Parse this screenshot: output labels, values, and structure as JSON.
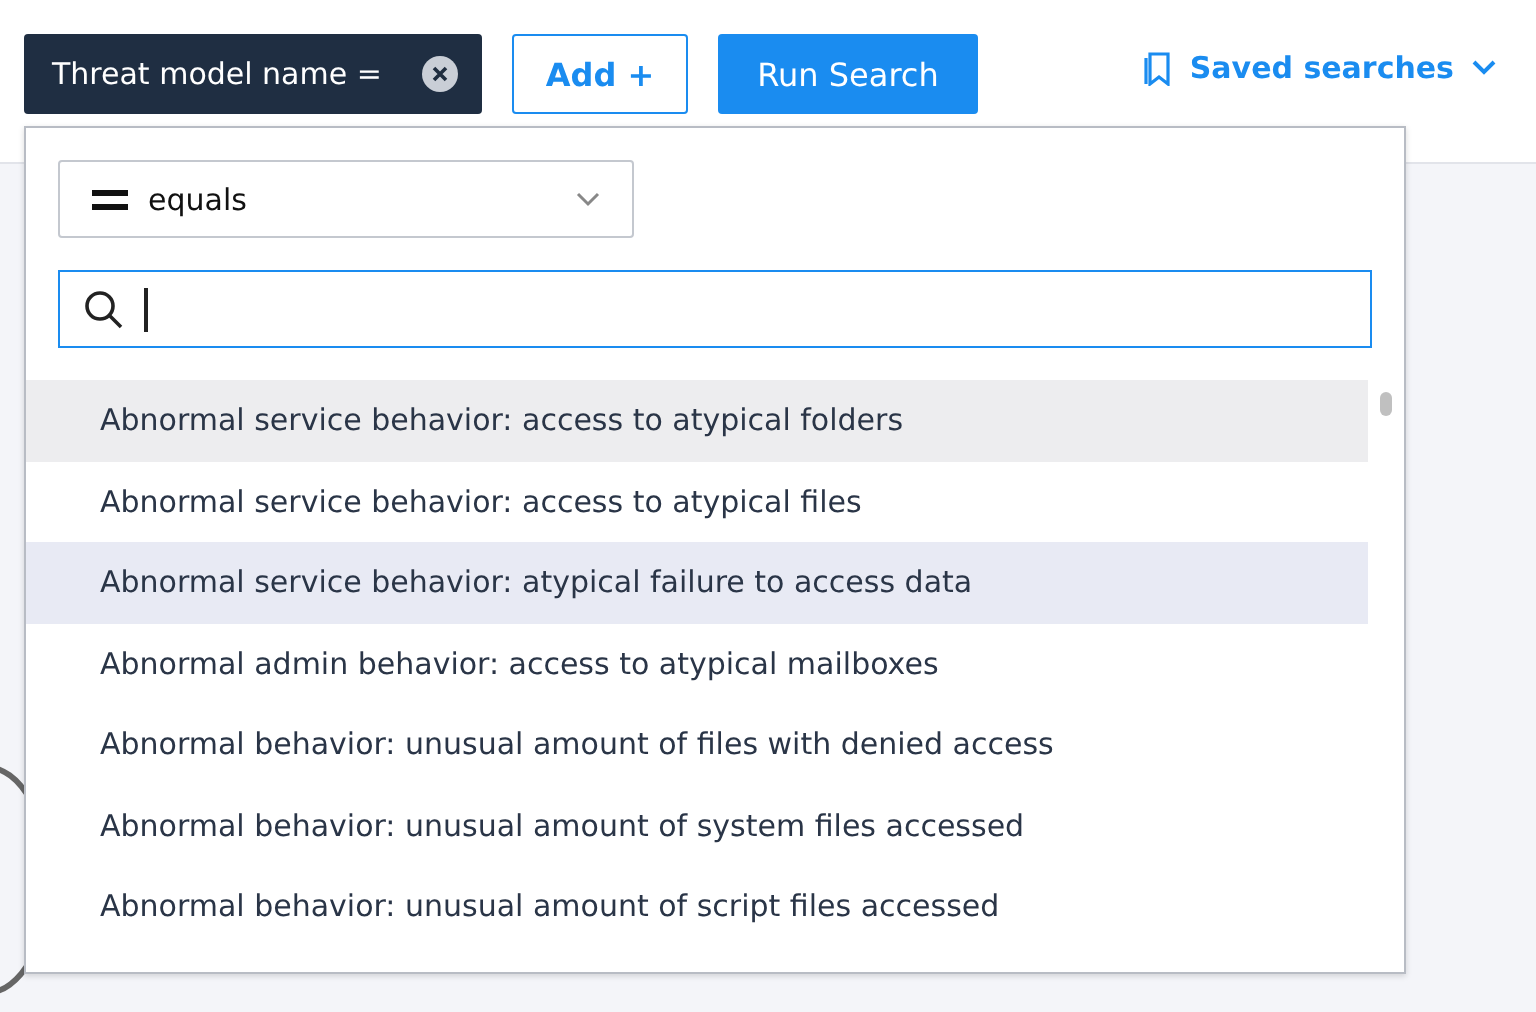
{
  "filter_chip": {
    "label": "Threat model name ="
  },
  "add_button": {
    "label": "Add +"
  },
  "run_button": {
    "label": "Run Search"
  },
  "saved_searches": {
    "label": "Saved searches"
  },
  "dropdown": {
    "operator": {
      "value": "equals"
    },
    "options": [
      {
        "label": "Abnormal service behavior: access to atypical folders",
        "hovered": true,
        "selected": false
      },
      {
        "label": "Abnormal service behavior: access to atypical files",
        "hovered": false,
        "selected": false
      },
      {
        "label": "Abnormal service behavior: atypical failure to access data",
        "hovered": false,
        "selected": true
      },
      {
        "label": "Abnormal admin behavior: access to atypical mailboxes",
        "hovered": false,
        "selected": false
      },
      {
        "label": "Abnormal behavior: unusual amount of files with denied access",
        "hovered": false,
        "selected": false
      },
      {
        "label": "Abnormal behavior: unusual amount of system files accessed",
        "hovered": false,
        "selected": false
      },
      {
        "label": "Abnormal behavior: unusual amount of script files accessed",
        "hovered": false,
        "selected": false
      }
    ]
  }
}
